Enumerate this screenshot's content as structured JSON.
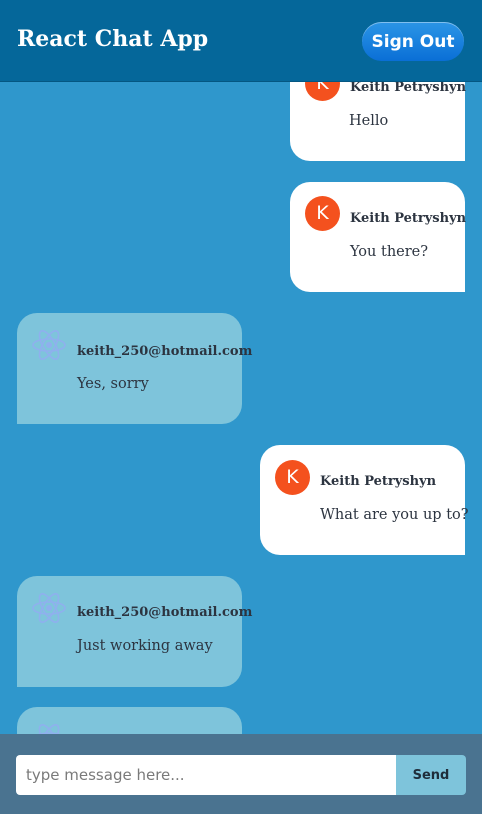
{
  "header": {
    "title": "React Chat App",
    "signout_label": "Sign Out"
  },
  "messages": [
    {
      "sender": "Keith Petryshyn",
      "avatar": "K",
      "text": "Hello",
      "type": "sent"
    },
    {
      "sender": "Keith Petryshyn",
      "avatar": "K",
      "text": "You there?",
      "type": "sent"
    },
    {
      "sender": "keith_250@hotmail.com",
      "avatar": "react-logo-icon",
      "text": "Yes, sorry",
      "type": "received"
    },
    {
      "sender": "Keith Petryshyn",
      "avatar": "K",
      "text": "What are you up to?",
      "type": "sent"
    },
    {
      "sender": "keith_250@hotmail.com",
      "avatar": "react-logo-icon",
      "text": "Just working away",
      "type": "received"
    },
    {
      "sender": "",
      "avatar": "react-logo-icon",
      "text": "",
      "type": "received"
    }
  ],
  "composer": {
    "placeholder": "type message here...",
    "value": "",
    "send_label": "Send"
  },
  "colors": {
    "header": "#05679a",
    "background": "#2f97cc",
    "sent_bubble": "#ffffff",
    "received_bubble": "#7ec4db",
    "avatar": "#f4511e",
    "composer": "#4a7390"
  }
}
